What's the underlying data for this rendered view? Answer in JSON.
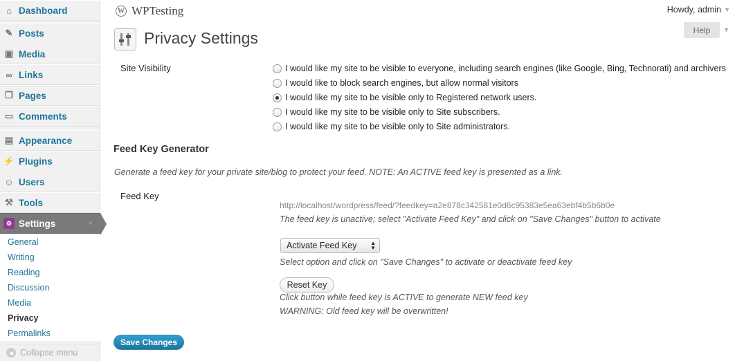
{
  "sidebar": {
    "items": [
      {
        "label": "Dashboard",
        "icon": "dashboard-icon"
      },
      {
        "label": "Posts",
        "icon": "pin-icon"
      },
      {
        "label": "Media",
        "icon": "media-icon"
      },
      {
        "label": "Links",
        "icon": "link-icon"
      },
      {
        "label": "Pages",
        "icon": "pages-icon"
      },
      {
        "label": "Comments",
        "icon": "comment-icon"
      },
      {
        "label": "Appearance",
        "icon": "appearance-icon"
      },
      {
        "label": "Plugins",
        "icon": "plugin-icon"
      },
      {
        "label": "Users",
        "icon": "users-icon"
      },
      {
        "label": "Tools",
        "icon": "tools-icon"
      },
      {
        "label": "Settings",
        "icon": "settings-icon"
      }
    ],
    "submenu": [
      "General",
      "Writing",
      "Reading",
      "Discussion",
      "Media",
      "Privacy",
      "Permalinks"
    ],
    "collapse_label": "Collapse menu"
  },
  "header": {
    "site_name": "WPTesting",
    "howdy": "Howdy, admin",
    "help": "Help"
  },
  "page": {
    "title": "Privacy Settings",
    "site_visibility_label": "Site Visibility",
    "visibility_options": [
      "I would like my site to be visible to everyone, including search engines (like Google, Bing, Technorati) and archivers",
      "I would like to block search engines, but allow normal visitors",
      "I would like my site to be visible only to Registered network users.",
      "I would like my site to be visible only to Site subscribers.",
      "I would like my site to be visible only to Site administrators."
    ],
    "selected_option_index": 2,
    "feed_section_title": "Feed Key Generator",
    "feed_section_desc": "Generate a feed key for your private site/blog to protect your feed. NOTE: An ACTIVE feed key is presented as a link.",
    "feed_key_label": "Feed Key",
    "feed_url": "http://localhost/wordpress/feed/?feedkey=a2e878c342581e0d6c95383e5ea63ebf4b5b6b0e",
    "feed_status_note": "The feed key is unactive; select \"Activate Feed Key\" and click on \"Save Changes\" button to activate",
    "select_value": "Activate Feed Key",
    "select_note": "Select option and click on \"Save Changes\" to activate or deactivate feed key",
    "reset_label": "Reset Key",
    "reset_note": "Click button while feed key is ACTIVE to generate NEW feed key",
    "warning_note": "WARNING: Old feed key will be overwritten!",
    "save_label": "Save Changes"
  }
}
